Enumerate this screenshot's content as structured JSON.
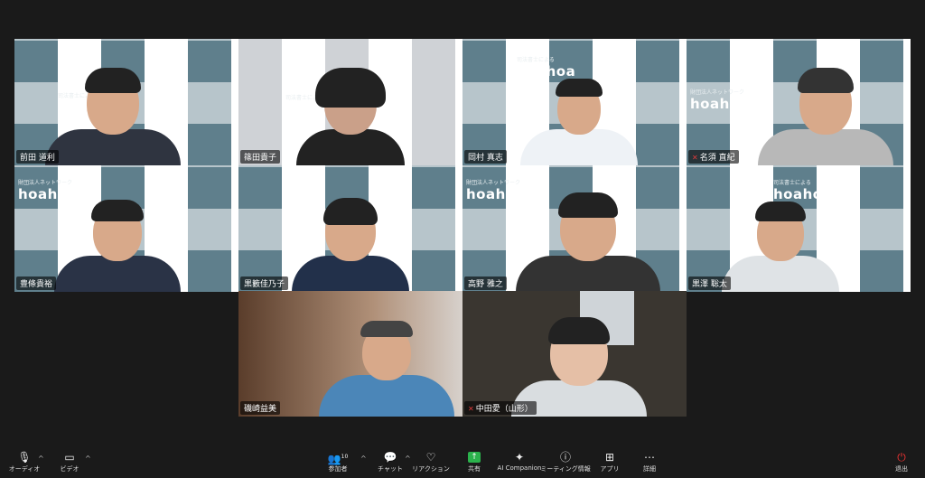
{
  "participants": [
    {
      "name": "前田 道利",
      "muted": false
    },
    {
      "name": "篠田貴子",
      "muted": false
    },
    {
      "name": "岡村 真志",
      "muted": false
    },
    {
      "name": "名須 直紀",
      "muted": true
    },
    {
      "name": "豊條貴裕",
      "muted": false
    },
    {
      "name": "黒籔佳乃子",
      "muted": false
    },
    {
      "name": "高野 雅之",
      "muted": false
    },
    {
      "name": "黒澤 聡太",
      "muted": false
    },
    {
      "name": "磯崎益美",
      "muted": false
    },
    {
      "name": "中田愛（山形）",
      "muted": true
    }
  ],
  "background_logo": {
    "text": "hoahoa",
    "line1": "司法書士による",
    "line2": "財団法人ネットワーク"
  },
  "toolbar": {
    "audio": "オーディオ",
    "video": "ビデオ",
    "participants": "参加者",
    "participants_count": "10",
    "chat": "チャット",
    "reactions": "リアクション",
    "share": "共有",
    "ai_companion": "AI Companion",
    "meeting_info": "ミーティング情報",
    "apps": "アプリ",
    "details": "詳細",
    "leave": "退出"
  },
  "colors": {
    "active_speaker": "#23d959",
    "share": "#2bb24c",
    "leave": "#e33333"
  }
}
